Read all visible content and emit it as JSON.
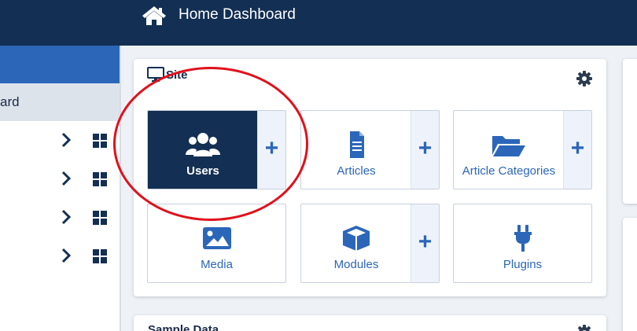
{
  "header": {
    "title": "Home Dashboard",
    "home_icon": "home-icon"
  },
  "sidebar": {
    "active_label": "ard",
    "rows": [
      {
        "chevron": "chevron-right-icon",
        "grid": "grid-icon"
      },
      {
        "chevron": "chevron-right-icon",
        "grid": "grid-icon"
      },
      {
        "chevron": "chevron-right-icon",
        "grid": "grid-icon"
      },
      {
        "chevron": "chevron-right-icon",
        "grid": "grid-icon"
      }
    ]
  },
  "site_card": {
    "title": "Site",
    "title_icon": "monitor-icon",
    "options_icon": "gear-icon",
    "tiles": [
      {
        "label": "Users",
        "icon": "users-icon",
        "add": "+"
      },
      {
        "label": "Articles",
        "icon": "file-icon",
        "add": "+"
      },
      {
        "label": "Article Categories",
        "icon": "folder-open-icon",
        "add": "+"
      },
      {
        "label": "Media",
        "icon": "image-icon"
      },
      {
        "label": "Modules",
        "icon": "cube-icon",
        "add": "+"
      },
      {
        "label": "Plugins",
        "icon": "plug-icon"
      }
    ]
  },
  "sample_card": {
    "title": "Sample Data",
    "options_icon": "gear-icon"
  },
  "colors": {
    "header": "#132f53",
    "sidebar_accent": "#2b66b9",
    "link": "#2b66b9",
    "highlight_circle": "#e0111c"
  }
}
